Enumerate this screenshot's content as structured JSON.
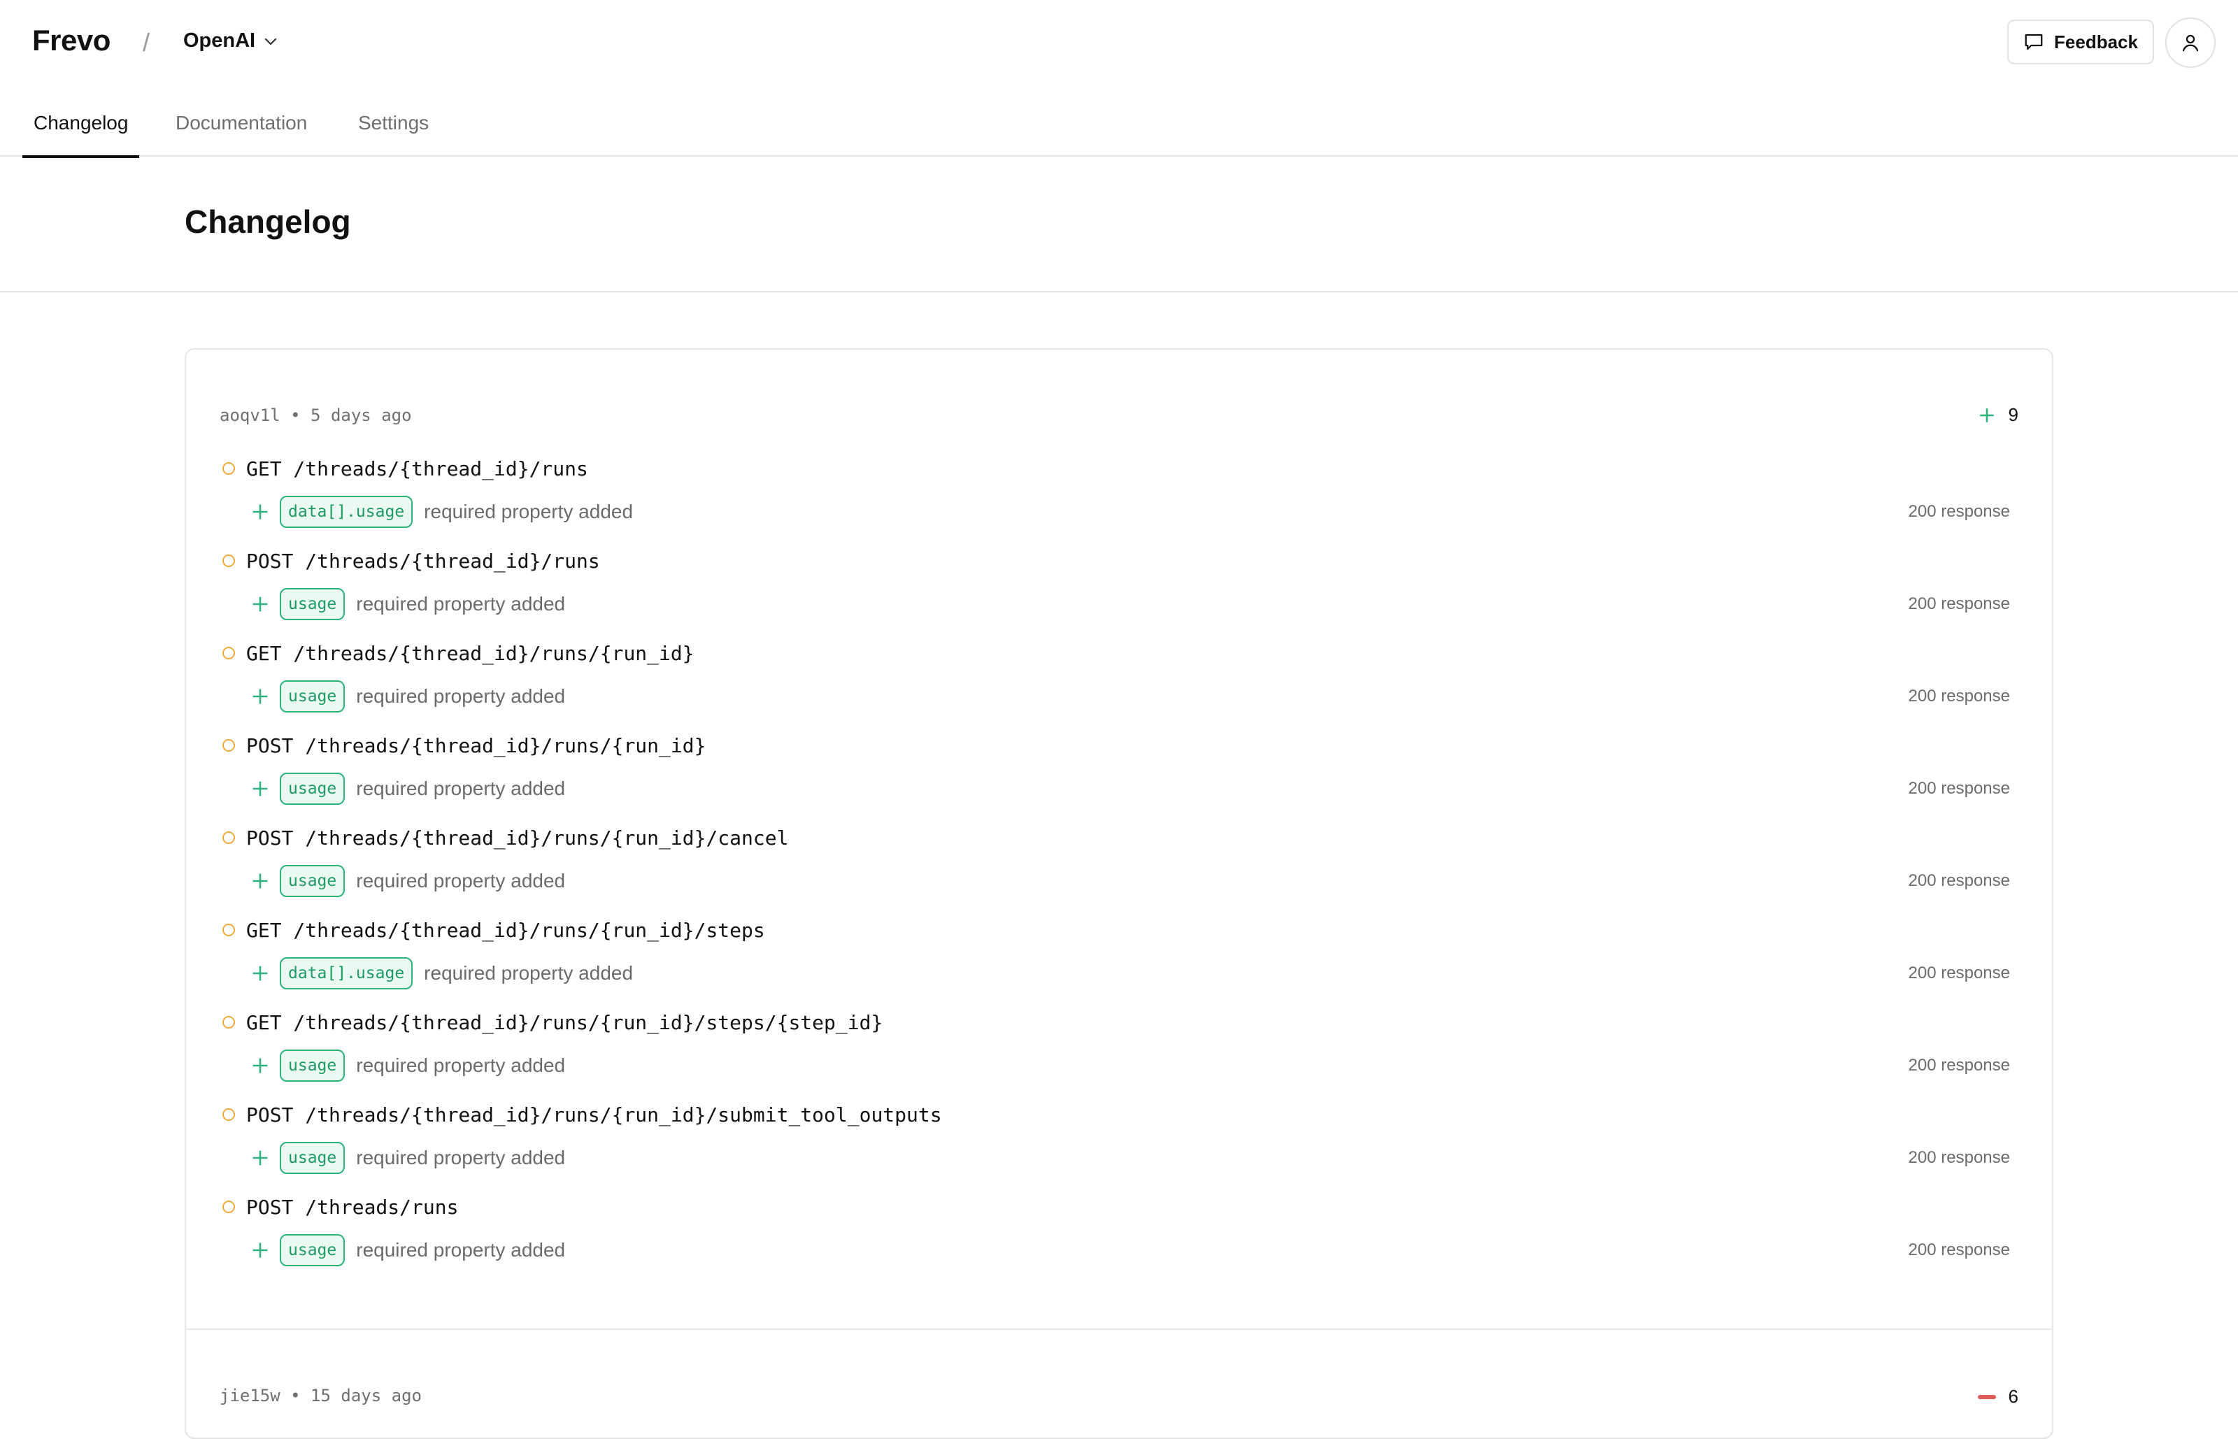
{
  "header": {
    "brand": "Frevo",
    "separator": "/",
    "org": "OpenAI",
    "feedback_label": "Feedback"
  },
  "tabs": [
    {
      "label": "Changelog",
      "active": true
    },
    {
      "label": "Documentation",
      "active": false
    },
    {
      "label": "Settings",
      "active": false
    }
  ],
  "page_title": "Changelog",
  "entries": [
    {
      "meta": "aoqv1l • 5 days ago",
      "count": "9",
      "changes": [
        {
          "method_path": "GET /threads/{thread_id}/runs",
          "property": "data[].usage",
          "description": "required property added",
          "response": "200 response"
        },
        {
          "method_path": "POST /threads/{thread_id}/runs",
          "property": "usage",
          "description": "required property added",
          "response": "200 response"
        },
        {
          "method_path": "GET /threads/{thread_id}/runs/{run_id}",
          "property": "usage",
          "description": "required property added",
          "response": "200 response"
        },
        {
          "method_path": "POST /threads/{thread_id}/runs/{run_id}",
          "property": "usage",
          "description": "required property added",
          "response": "200 response"
        },
        {
          "method_path": "POST /threads/{thread_id}/runs/{run_id}/cancel",
          "property": "usage",
          "description": "required property added",
          "response": "200 response"
        },
        {
          "method_path": "GET /threads/{thread_id}/runs/{run_id}/steps",
          "property": "data[].usage",
          "description": "required property added",
          "response": "200 response"
        },
        {
          "method_path": "GET /threads/{thread_id}/runs/{run_id}/steps/{step_id}",
          "property": "usage",
          "description": "required property added",
          "response": "200 response"
        },
        {
          "method_path": "POST /threads/{thread_id}/runs/{run_id}/submit_tool_outputs",
          "property": "usage",
          "description": "required property added",
          "response": "200 response"
        },
        {
          "method_path": "POST /threads/runs",
          "property": "usage",
          "description": "required property added",
          "response": "200 response"
        }
      ]
    },
    {
      "meta": "jie15w • 15 days ago",
      "count": "6"
    }
  ],
  "colors": {
    "added": "#2fb37a",
    "changed_dot": "#f2a93b",
    "removed": "#e05a5a"
  }
}
